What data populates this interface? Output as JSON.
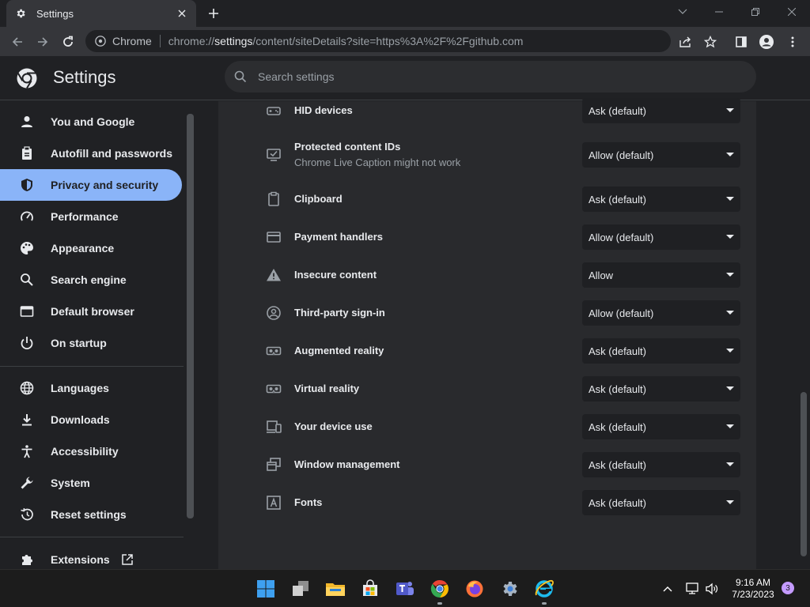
{
  "window": {
    "tab_title": "Settings",
    "omnibox_label": "Chrome",
    "url_prefix": "chrome://",
    "url_host": "settings",
    "url_rest": "/content/siteDetails?site=https%3A%2F%2Fgithub.com"
  },
  "header": {
    "title": "Settings",
    "search_placeholder": "Search settings"
  },
  "sidebar": {
    "items": [
      {
        "label": "You and Google",
        "icon": "person-icon"
      },
      {
        "label": "Autofill and passwords",
        "icon": "clipboard-icon"
      },
      {
        "label": "Privacy and security",
        "icon": "shield-icon",
        "active": true
      },
      {
        "label": "Performance",
        "icon": "speedometer-icon"
      },
      {
        "label": "Appearance",
        "icon": "palette-icon"
      },
      {
        "label": "Search engine",
        "icon": "search-icon"
      },
      {
        "label": "Default browser",
        "icon": "browser-window-icon"
      },
      {
        "label": "On startup",
        "icon": "power-icon"
      },
      {
        "label": "Languages",
        "icon": "globe-icon"
      },
      {
        "label": "Downloads",
        "icon": "download-icon"
      },
      {
        "label": "Accessibility",
        "icon": "accessibility-icon"
      },
      {
        "label": "System",
        "icon": "wrench-icon"
      },
      {
        "label": "Reset settings",
        "icon": "restore-icon"
      },
      {
        "label": "Extensions",
        "icon": "puzzle-icon"
      }
    ]
  },
  "permissions": [
    {
      "label": "HID devices",
      "value": "Ask (default)",
      "icon": "gamepad-icon"
    },
    {
      "label": "Protected content IDs",
      "sublabel": "Chrome Live Caption might not work",
      "value": "Allow (default)",
      "icon": "protected-content-icon"
    },
    {
      "label": "Clipboard",
      "value": "Ask (default)",
      "icon": "clipboard-icon"
    },
    {
      "label": "Payment handlers",
      "value": "Allow (default)",
      "icon": "credit-card-icon"
    },
    {
      "label": "Insecure content",
      "value": "Allow",
      "icon": "warning-icon"
    },
    {
      "label": "Third-party sign-in",
      "value": "Allow (default)",
      "icon": "account-circle-icon"
    },
    {
      "label": "Augmented reality",
      "value": "Ask (default)",
      "icon": "vr-headset-icon"
    },
    {
      "label": "Virtual reality",
      "value": "Ask (default)",
      "icon": "vr-headset-icon"
    },
    {
      "label": "Your device use",
      "value": "Ask (default)",
      "icon": "devices-icon"
    },
    {
      "label": "Window management",
      "value": "Ask (default)",
      "icon": "window-management-icon"
    },
    {
      "label": "Fonts",
      "value": "Ask (default)",
      "icon": "font-icon"
    }
  ],
  "taskbar": {
    "time": "9:16 AM",
    "date": "7/23/2023",
    "notification_count": "3"
  },
  "colors": {
    "accent": "#8ab4f8",
    "background": "#202124",
    "card": "#292a2d"
  }
}
